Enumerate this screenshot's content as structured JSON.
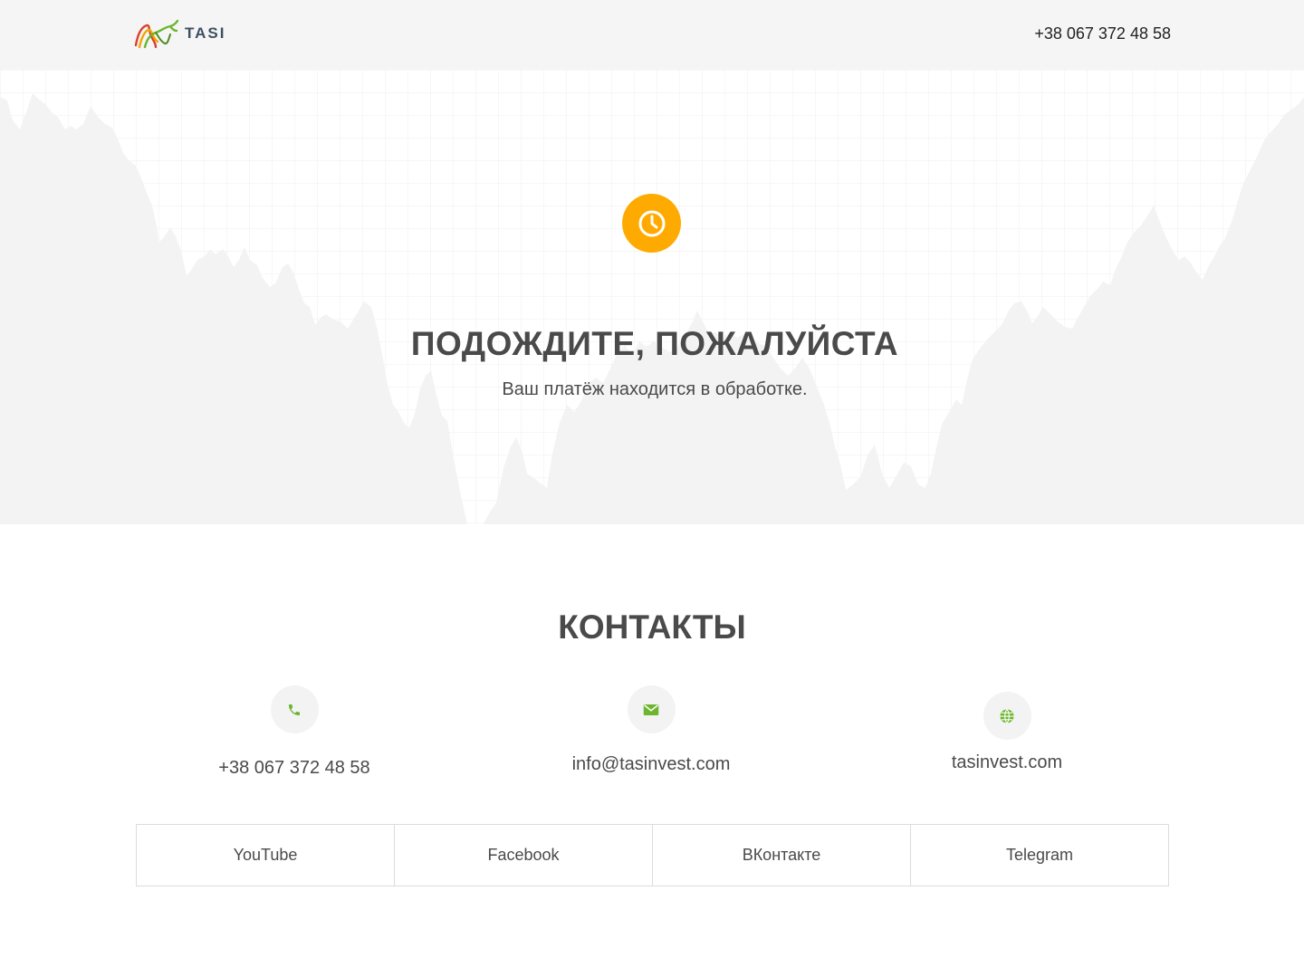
{
  "header": {
    "logo_text": "TASI",
    "phone": "+38 067 372 48 58"
  },
  "hero": {
    "status_icon": "clock-icon",
    "status_color": "#ffaa00",
    "title": "ПОДОЖДИТЕ, ПОЖАЛУЙСТА",
    "subtitle": "Ваш платёж находится в обработке."
  },
  "contacts": {
    "title": "КОНТАКТЫ",
    "items": [
      {
        "icon": "phone-icon",
        "value": "+38 067 372 48 58"
      },
      {
        "icon": "mail-icon",
        "value": "info@tasinvest.com"
      },
      {
        "icon": "globe-icon",
        "value": "tasinvest.com"
      }
    ],
    "icon_color": "#6cb52d"
  },
  "socials": [
    {
      "label": "YouTube"
    },
    {
      "label": "Facebook"
    },
    {
      "label": "ВКонтакте"
    },
    {
      "label": "Telegram"
    }
  ]
}
